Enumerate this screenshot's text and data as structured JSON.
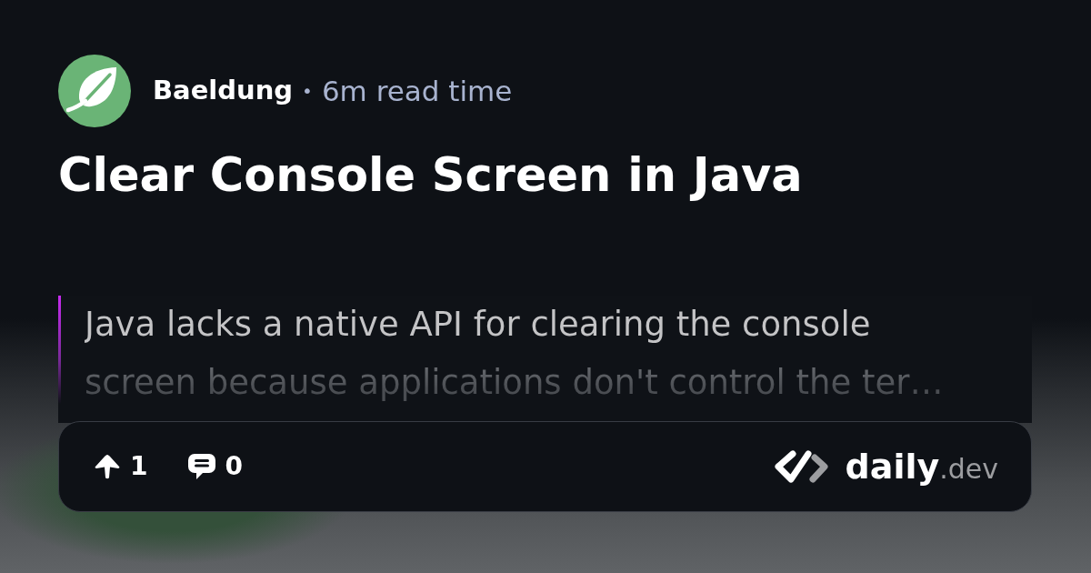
{
  "source": {
    "name": "Baeldung",
    "separator": "•",
    "read_time": "6m read time"
  },
  "title": "Clear Console Screen in Java",
  "summary": "Java lacks a native API for clearing the console screen because applications don't control the ter…",
  "actions": [
    {
      "kind": "upvote",
      "count": "1"
    },
    {
      "kind": "comment",
      "count": "0"
    }
  ],
  "brand": {
    "name": "daily",
    "suffix": ".dev"
  }
}
